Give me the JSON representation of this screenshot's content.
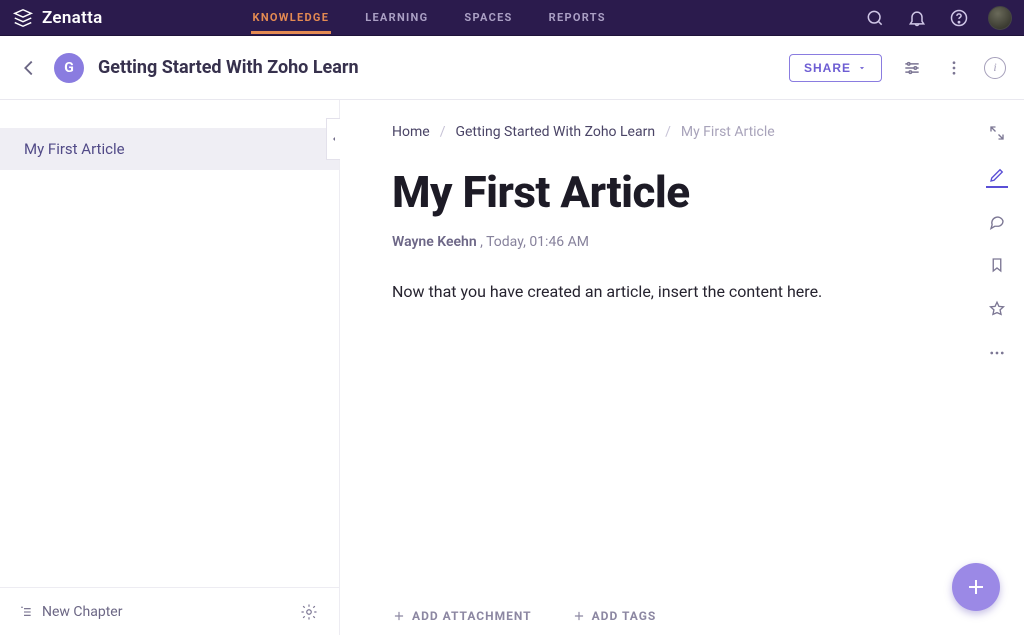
{
  "brand": {
    "name": "Zenatta"
  },
  "nav": {
    "tabs": [
      {
        "label": "KNOWLEDGE",
        "active": true
      },
      {
        "label": "LEARNING",
        "active": false
      },
      {
        "label": "SPACES",
        "active": false
      },
      {
        "label": "REPORTS",
        "active": false
      }
    ]
  },
  "subheader": {
    "badge_letter": "G",
    "title": "Getting Started With Zoho Learn",
    "share_label": "SHARE"
  },
  "sidebar": {
    "items": [
      {
        "label": "My First Article",
        "active": true
      }
    ],
    "new_chapter_label": "New Chapter"
  },
  "breadcrumbs": {
    "items": [
      {
        "label": "Home",
        "dim": false
      },
      {
        "label": "Getting Started With Zoho Learn",
        "dim": false
      },
      {
        "label": "My First Article",
        "dim": true
      }
    ]
  },
  "article": {
    "title": "My First Article",
    "author": "Wayne Keehn",
    "timestamp": "Today, 01:46 AM",
    "body": "Now that you have created an article, insert the content here."
  },
  "footer_actions": {
    "add_attachment": "ADD ATTACHMENT",
    "add_tags": "ADD TAGS"
  }
}
